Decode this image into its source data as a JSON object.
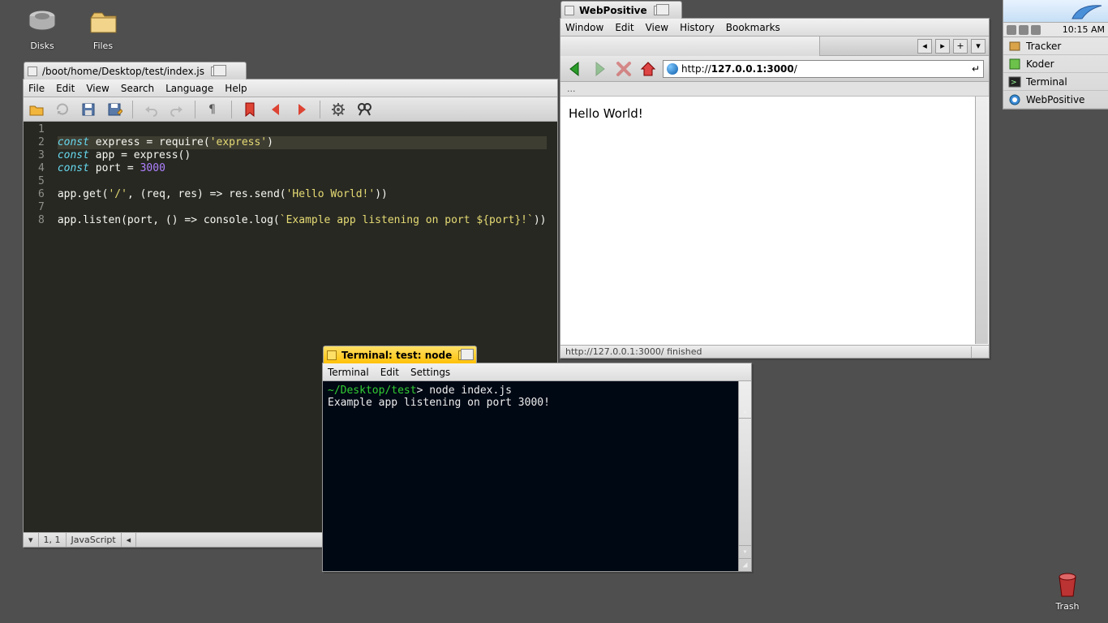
{
  "desktop": {
    "icons": [
      {
        "label": "Disks"
      },
      {
        "label": "Files"
      },
      {
        "label": "Trash"
      }
    ]
  },
  "deskbar": {
    "clock": "10:15 AM",
    "apps": [
      {
        "label": "Tracker"
      },
      {
        "label": "Koder"
      },
      {
        "label": "Terminal"
      },
      {
        "label": "WebPositive"
      }
    ]
  },
  "koder": {
    "title": "/boot/home/Desktop/test/index.js",
    "menu": [
      "File",
      "Edit",
      "View",
      "Search",
      "Language",
      "Help"
    ],
    "status": {
      "pos": "1, 1",
      "lang": "JavaScript"
    },
    "lines": [
      "1",
      "2",
      "3",
      "4",
      "5",
      "6",
      "7",
      "8"
    ],
    "code": {
      "l1a": "const",
      "l1b": " express = require(",
      "l1c": "'express'",
      "l1d": ")",
      "l2a": "const",
      "l2b": " app = express()",
      "l3a": "const",
      "l3b": " port = ",
      "l3c": "3000",
      "l5a": "app.get(",
      "l5b": "'/'",
      "l5c": ", (req, res) => res.send(",
      "l5d": "'Hello World!'",
      "l5e": "))",
      "l7a": "app.listen(port, () => console.log(",
      "l7b": "`Example app listening on port ${port}!`",
      "l7c": "))"
    }
  },
  "terminal": {
    "title": "Terminal: test: node",
    "menu": [
      "Terminal",
      "Edit",
      "Settings"
    ],
    "prompt": "~/Desktop/test",
    "cmd": "> node index.js",
    "out": "Example app listening on port 3000!"
  },
  "web": {
    "title": "WebPositive",
    "menu": [
      "Window",
      "Edit",
      "View",
      "History",
      "Bookmarks"
    ],
    "url_prefix": "http://",
    "url_bold": "127.0.0.1:3000",
    "url_suffix": "/",
    "crumb": "...",
    "content": "Hello World!",
    "status": "http://127.0.0.1:3000/ finished"
  }
}
